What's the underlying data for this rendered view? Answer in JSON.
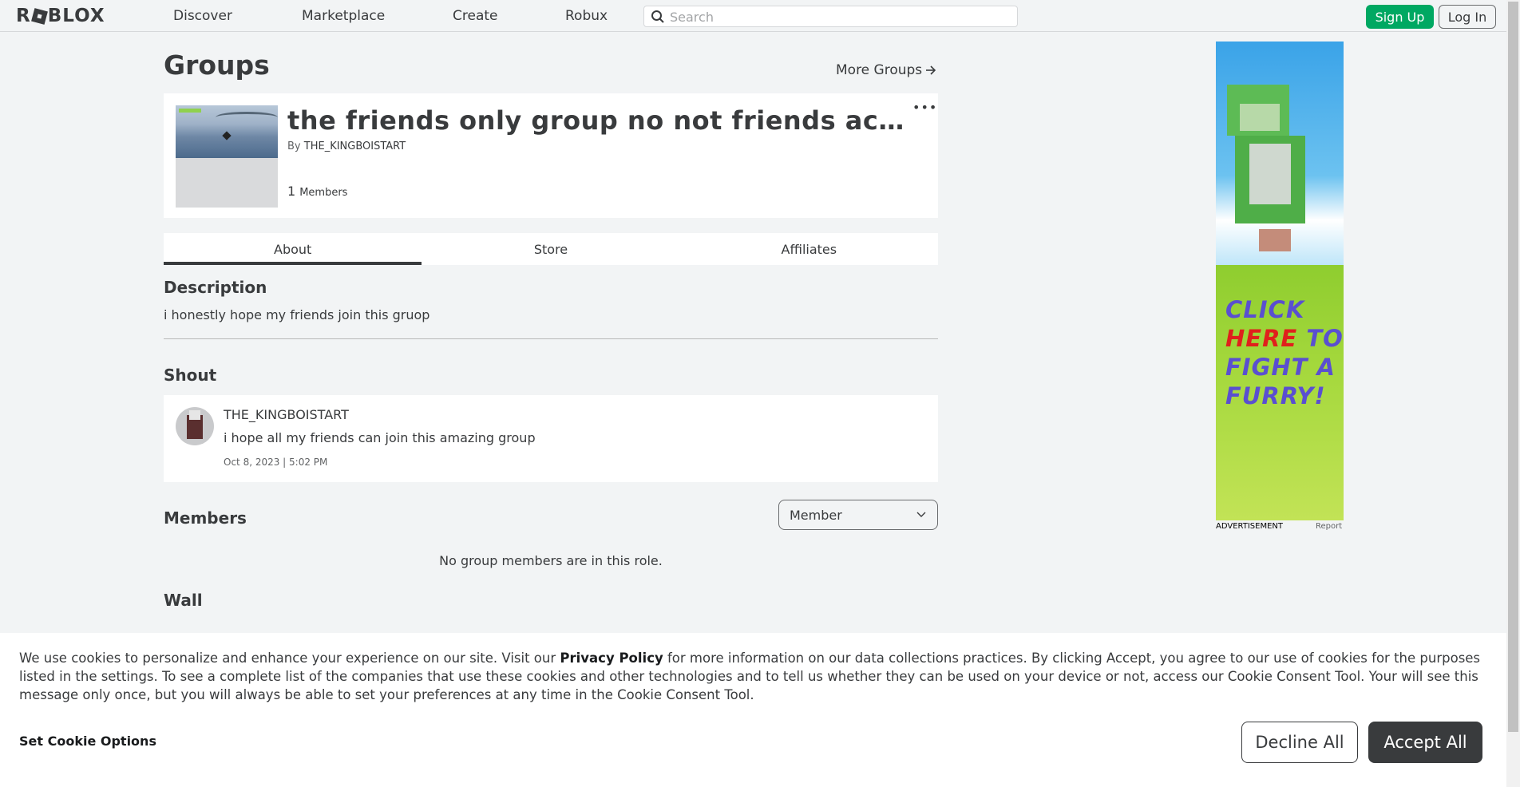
{
  "header": {
    "logo_text_1": "R",
    "logo_text_2": "BLOX",
    "nav": [
      "Discover",
      "Marketplace",
      "Create",
      "Robux"
    ],
    "search_placeholder": "Search",
    "signup_label": "Sign Up",
    "login_label": "Log In"
  },
  "page": {
    "title": "Groups",
    "more_groups": "More Groups"
  },
  "group": {
    "name": "the friends only group no not friends acceo...",
    "by_label": "By",
    "owner": "THE_KINGBOISTART",
    "member_count": "1",
    "members_label": "Members",
    "more_label": "•••"
  },
  "tabs": [
    {
      "label": "About",
      "active": true
    },
    {
      "label": "Store",
      "active": false
    },
    {
      "label": "Affiliates",
      "active": false
    }
  ],
  "description": {
    "title": "Description",
    "text": "i honestly hope my friends join this gruop"
  },
  "shout": {
    "title": "Shout",
    "user": "THE_KINGBOISTART",
    "message": "i hope all my friends can join this amazing group",
    "date": "Oct 8, 2023 | 5:02 PM"
  },
  "members": {
    "title": "Members",
    "role_selected": "Member",
    "empty_text": "No group members are in this role."
  },
  "wall": {
    "title": "Wall"
  },
  "ad": {
    "text_line1": "CLICK",
    "text_line2a": "HERE",
    "text_line2b": " TO",
    "text_line3": "FIGHT A",
    "text_line4": "FURRY!",
    "label": "ADVERTISEMENT",
    "report": "Report"
  },
  "cookie": {
    "text_before": "We use cookies to personalize and enhance your experience on our site. Visit our ",
    "privacy_link": "Privacy Policy",
    "text_after": " for more information on our data collections practices. By clicking Accept, you agree to our use of cookies for the purposes listed in the settings. To see a complete list of the companies that use these cookies and other technologies and to tell us whether they can be used on your device or not, access our Cookie Consent Tool. Your will see this message only once, but you will always be able to set your preferences at any time in the Cookie Consent Tool.",
    "options_label": "Set Cookie Options",
    "decline_label": "Decline All",
    "accept_label": "Accept All"
  },
  "colors": {
    "signup_green": "#00a862",
    "text_dark": "#393b3d",
    "page_bg": "#f2f4f5"
  }
}
